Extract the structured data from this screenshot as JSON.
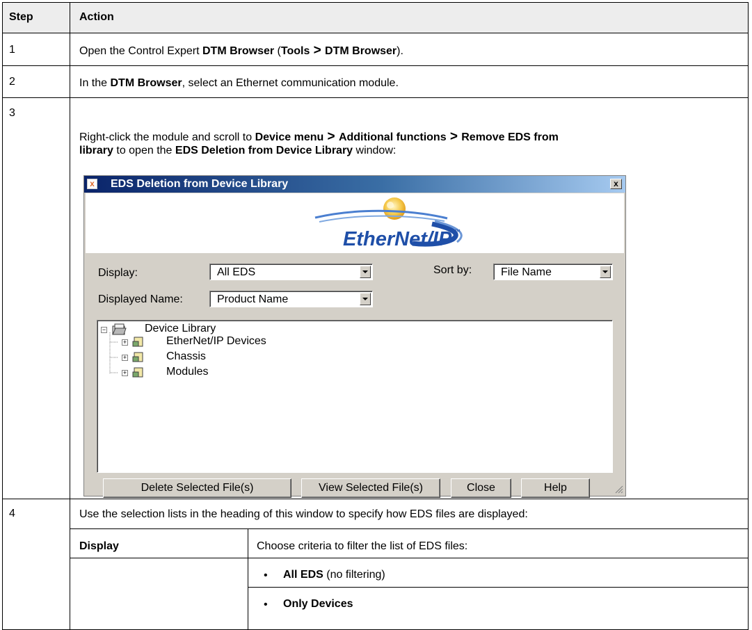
{
  "table": {
    "headers": {
      "step": "Step",
      "action": "Action"
    },
    "rows": [
      {
        "step": "1",
        "parts": [
          "Open the Control Expert ",
          "DTM Browser",
          " (",
          "Tools",
          " > ",
          "DTM Browser",
          ")."
        ]
      },
      {
        "step": "2",
        "parts": [
          "In the ",
          "DTM Browser",
          ", select an Ethernet communication module."
        ]
      },
      {
        "step": "3",
        "line1": [
          "Right-click the module and scroll to ",
          "Device menu",
          " > ",
          "Additional functions",
          " > ",
          "Remove EDS from"
        ],
        "line2": [
          "library",
          " to open the ",
          "EDS Deletion from Device Library",
          " window:"
        ]
      },
      {
        "step": "4",
        "text": "Use the selection lists in the heading of this window to specify how EDS files are displayed:"
      }
    ],
    "subtable": {
      "term": "Display",
      "description": "Choose criteria to filter the list of EDS files:",
      "bullets": [
        {
          "bold": "All EDS",
          "rest": " (no filtering)"
        },
        {
          "bold": "Only Devices",
          "rest": ""
        }
      ]
    }
  },
  "dialog": {
    "title": "EDS Deletion from Device Library",
    "title_icon": "x",
    "close_glyph": "x",
    "logo_text": "EtherNet/IP",
    "logo_tm": "™",
    "display_label": "Display:",
    "display_value": "All EDS",
    "sort_label": "Sort by:",
    "sort_value": "File Name",
    "displayed_name_label": "Displayed Name:",
    "displayed_name_value": "Product Name",
    "tree": {
      "root": "Device Library",
      "children": [
        "EtherNet/IP Devices",
        "Chassis",
        "Modules"
      ]
    },
    "buttons": {
      "delete": "Delete Selected File(s)",
      "view": "View Selected File(s)",
      "close": "Close",
      "help": "Help"
    }
  },
  "colors": {
    "header_bg": "#ededed",
    "dialog_bg": "#d4d0c8",
    "titlebar_start": "#0a246a",
    "titlebar_end": "#a6caf0",
    "logo_blue": "#1f4fa8"
  }
}
